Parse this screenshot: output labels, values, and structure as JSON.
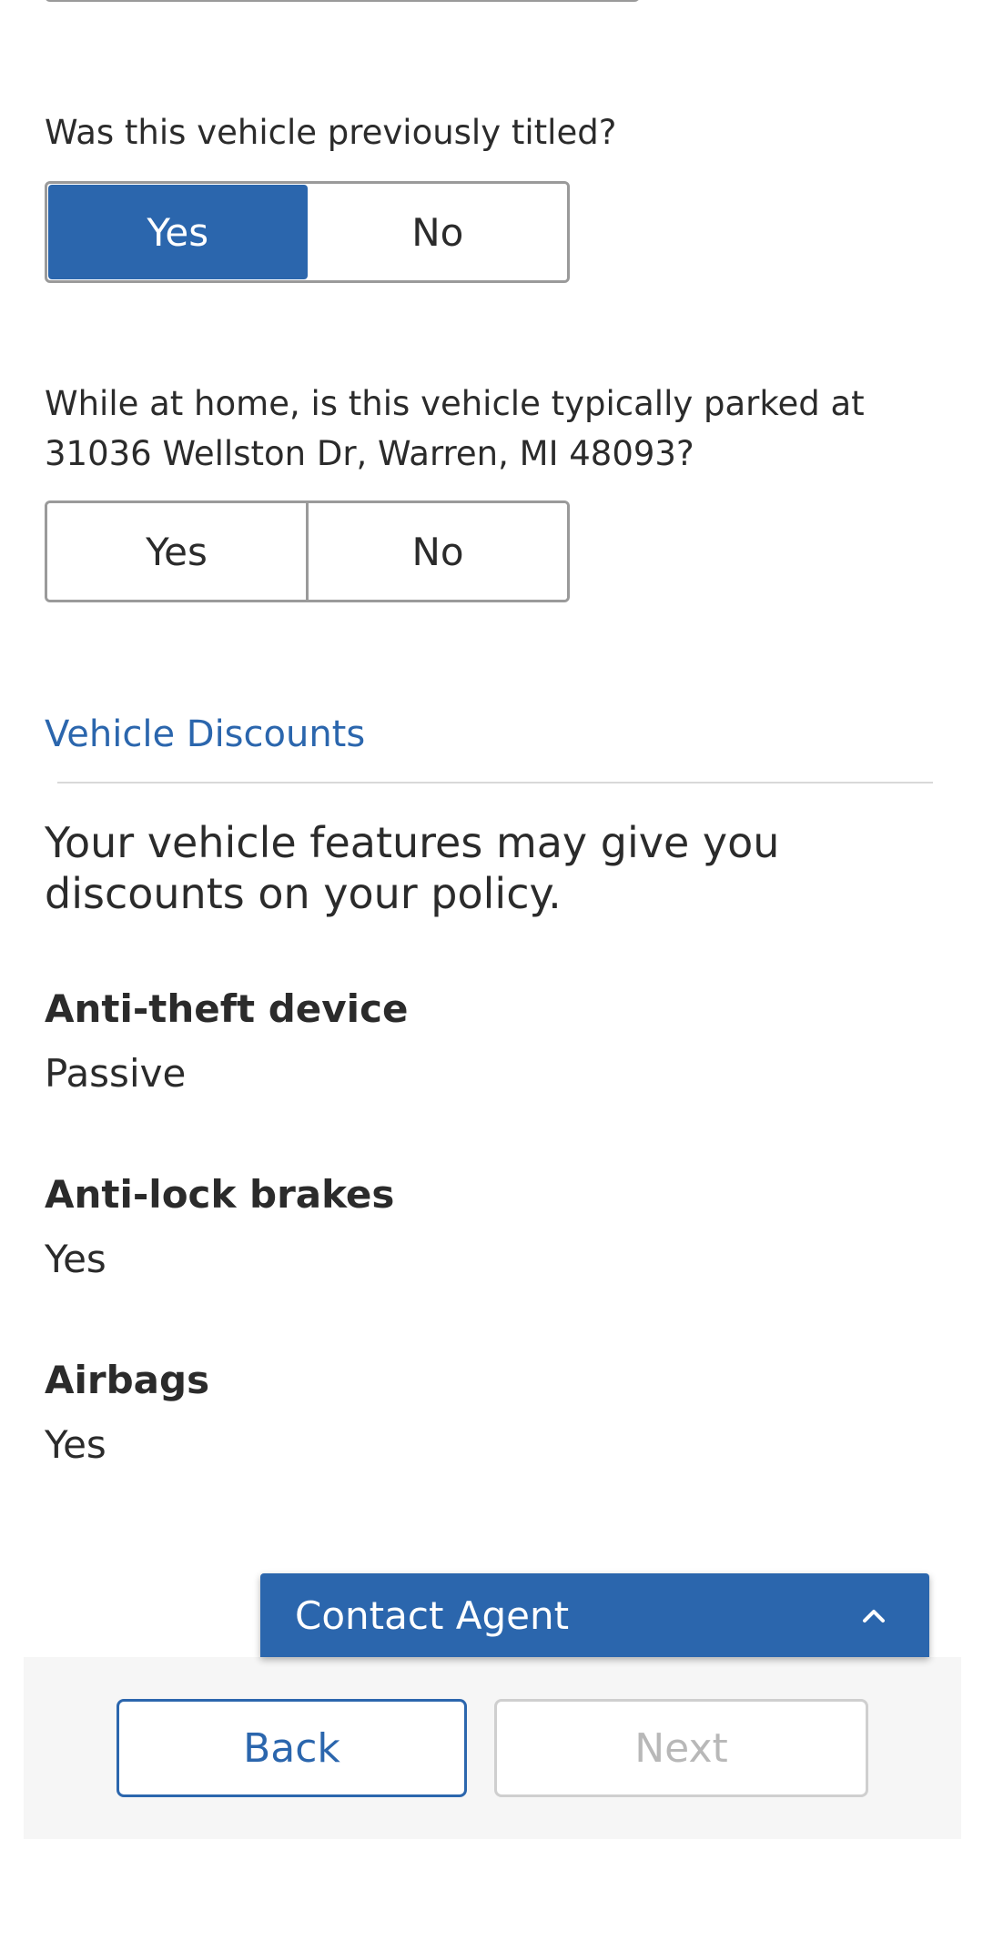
{
  "questions": {
    "previously_titled": {
      "label": "Was this vehicle previously titled?",
      "options": [
        "Yes",
        "No"
      ],
      "selected": "Yes"
    },
    "parked_at_home": {
      "label": "While at home, is this vehicle typically parked at 31036 Wellston Dr, Warren, MI 48093?",
      "options": [
        "Yes",
        "No"
      ],
      "selected": null
    }
  },
  "discounts": {
    "title": "Vehicle Discounts",
    "intro": "Your vehicle features may give you discounts on your policy.",
    "features": [
      {
        "label": "Anti-theft device",
        "value": "Passive"
      },
      {
        "label": "Anti-lock brakes",
        "value": "Yes"
      },
      {
        "label": "Airbags",
        "value": "Yes"
      }
    ]
  },
  "contact_agent": {
    "label": "Contact Agent",
    "icon": "chevron-up-icon"
  },
  "footer": {
    "back_label": "Back",
    "next_label": "Next"
  },
  "colors": {
    "accent": "#2b66ad",
    "text": "#2b2b2b",
    "border": "#9a9a9a",
    "disabled": "#b8b8b8"
  }
}
